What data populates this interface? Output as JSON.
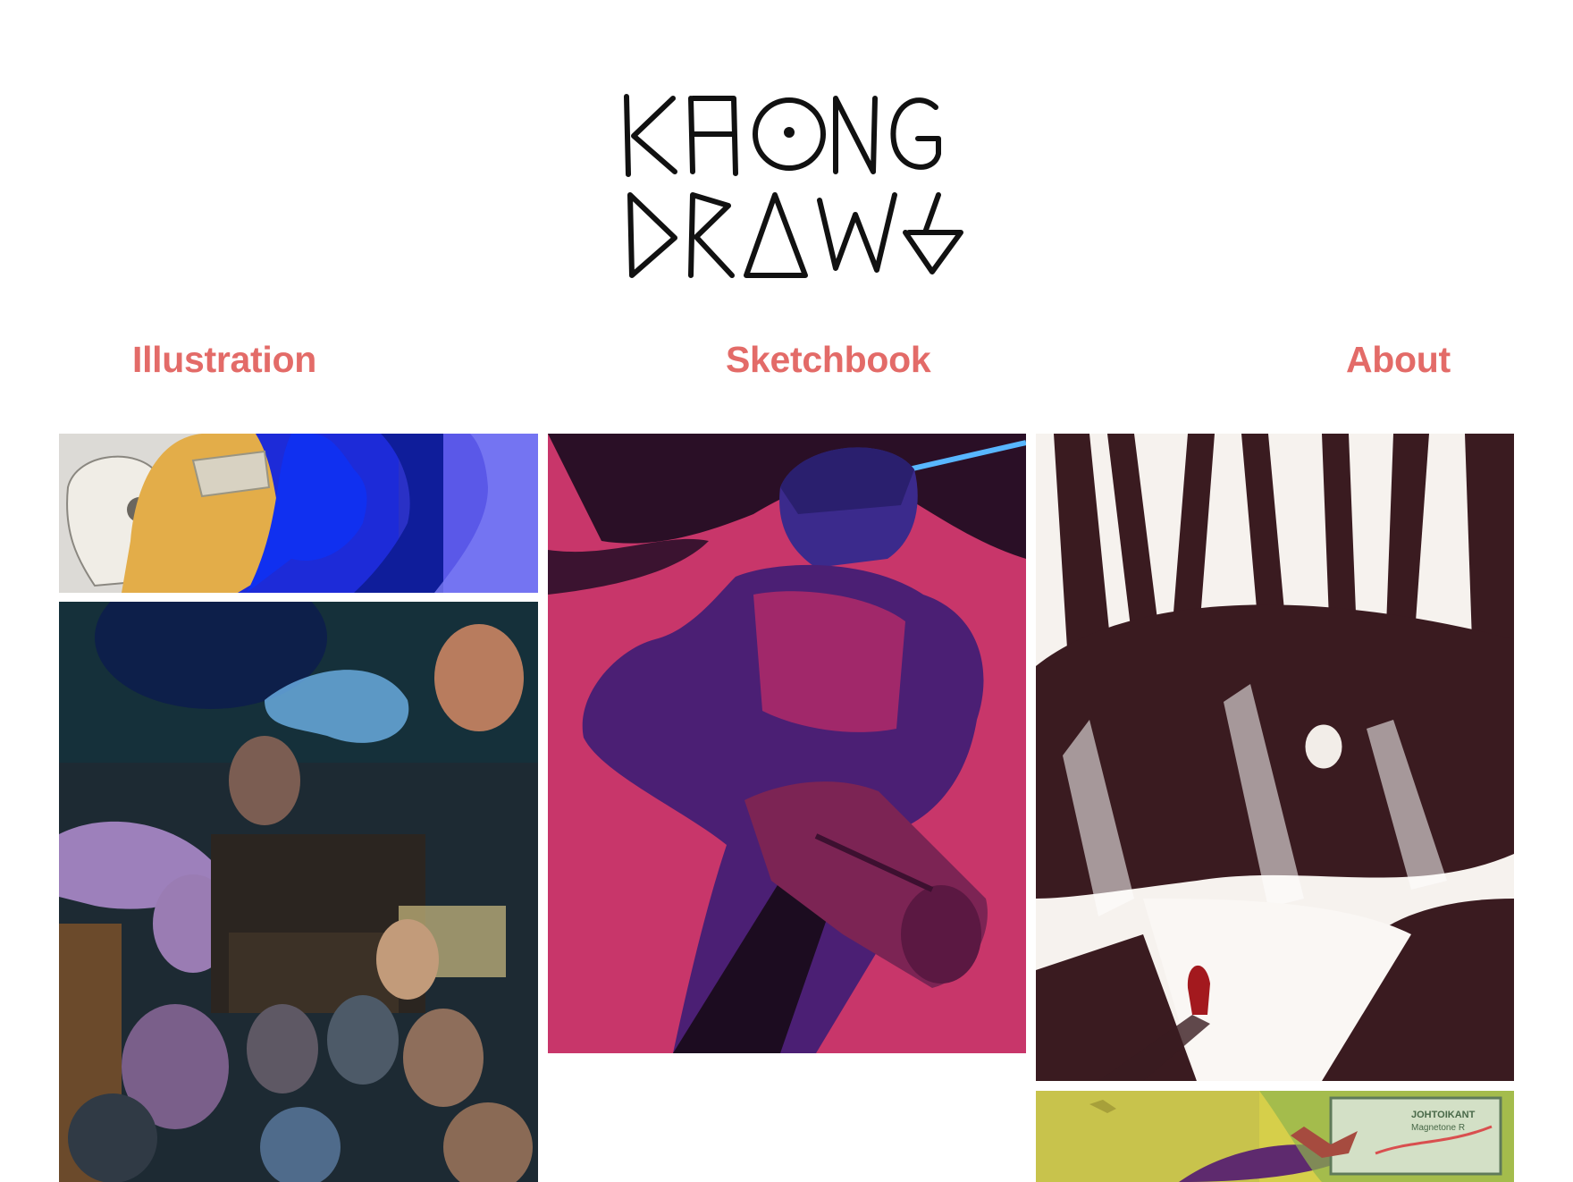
{
  "site": {
    "logo_text": "KHONG DRAWS",
    "logo_line_1": "KHONG",
    "logo_line_2": "DRAWS",
    "accent_color": "#e36b68"
  },
  "nav": {
    "items": [
      {
        "label": "Illustration"
      },
      {
        "label": "Sketchbook"
      },
      {
        "label": "About"
      }
    ]
  },
  "gallery": {
    "tiles": [
      {
        "subject": "profiles with skull and VR visor"
      },
      {
        "subject": "crowded sci-fi ensemble poster"
      },
      {
        "subject": "space helmet figure with blaster on pink"
      },
      {
        "subject": "ink forest with figure in red hood"
      },
      {
        "subject": "illustrated map with bird"
      }
    ],
    "map_tile_text": {
      "line1": "JOHTOIKANT",
      "line2": "Magnetone R"
    }
  }
}
